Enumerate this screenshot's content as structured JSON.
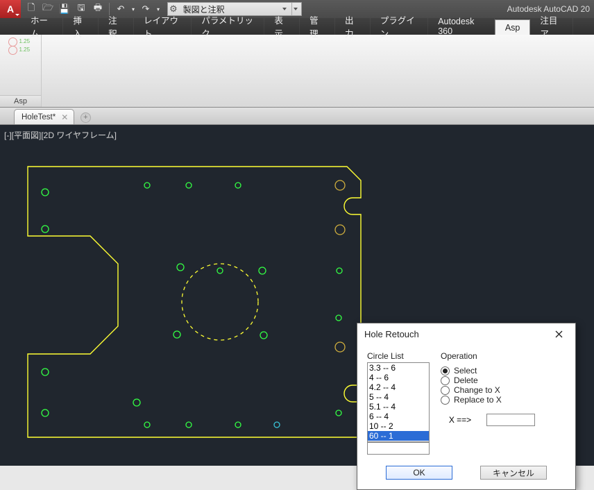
{
  "app_icon_letter": "A",
  "title_text": "Autodesk AutoCAD 20",
  "workspace": {
    "label": "製図と注釈"
  },
  "ribbon": {
    "tabs": [
      "ホーム",
      "挿入",
      "注釈",
      "レイアウト",
      "パラメトリック",
      "表示",
      "管理",
      "出力",
      "プラグイン",
      "Autodesk 360",
      "Asp",
      "注目ア"
    ],
    "active_index": 10,
    "panel_label": "Asp",
    "panel_icon_txt1": "1.25",
    "panel_icon_txt2": "1.25"
  },
  "drawing_tab": {
    "name": "HoleTest*"
  },
  "canvas": {
    "view_label": "[-][平面図][2D ワイヤフレーム]"
  },
  "dialog": {
    "title": "Hole Retouch",
    "circle_list_label": "Circle List",
    "items": [
      "3.3 -- 6",
      "4 -- 6",
      "4.2 -- 4",
      "5 -- 4",
      "5.1 -- 4",
      "6 -- 4",
      "10 -- 2",
      "60 -- 1"
    ],
    "selected_index": 7,
    "operation_label": "Operation",
    "ops": [
      "Select",
      "Delete",
      "Change  to X",
      "Replace to X"
    ],
    "op_selected": 0,
    "x_label": "X  ==>",
    "x_value": "",
    "ok": "OK",
    "cancel": "キャンセル"
  }
}
